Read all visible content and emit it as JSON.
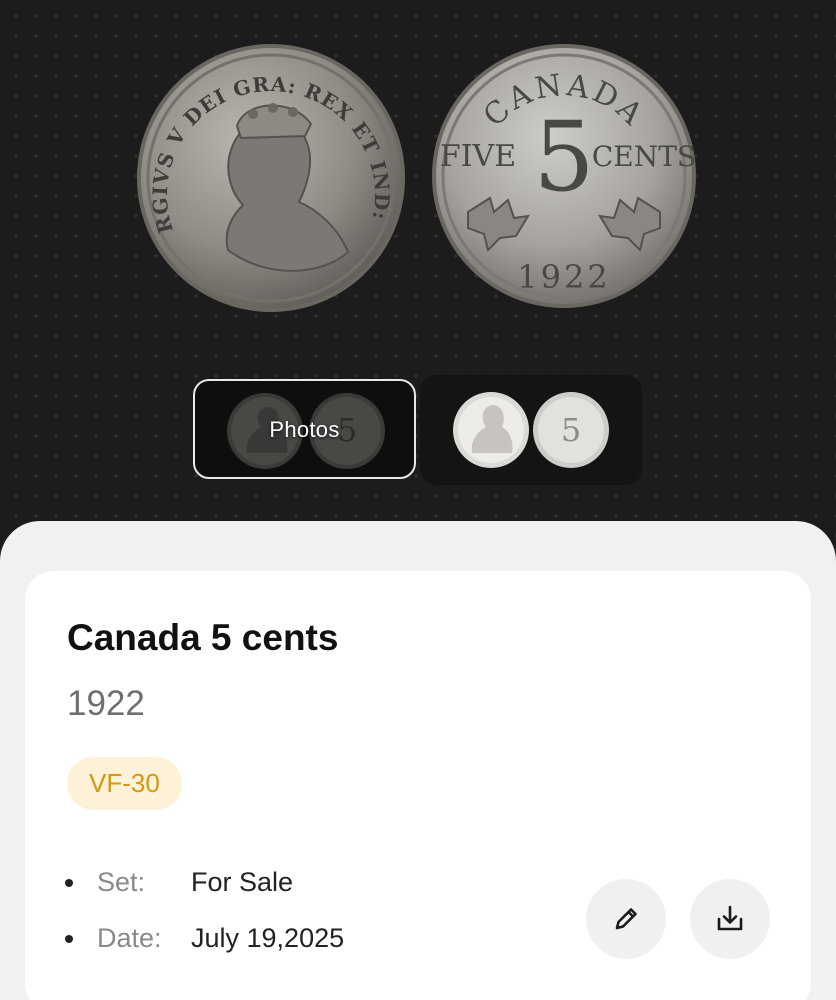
{
  "coin": {
    "obverse_legend": "GEORGIVS V DEI GRA: REX ET IND: IMP:",
    "reverse_country": "CANADA",
    "reverse_left": "FIVE",
    "reverse_center": "5",
    "reverse_right": "CENTS",
    "reverse_year": "1922"
  },
  "gallery": {
    "photos_label": "Photos"
  },
  "details": {
    "title": "Canada 5 cents",
    "year": "1922",
    "grade": "VF-30",
    "set_label": "Set:",
    "set_value": "For Sale",
    "date_label": "Date:",
    "date_value": "July 19,2025"
  },
  "actions": {
    "edit_icon": "pencil-icon",
    "download_icon": "download-icon"
  },
  "colors": {
    "hero_bg": "#1c1c1c",
    "sheet_bg": "#f1f1f1",
    "grade_bg": "#fdf1d8",
    "grade_text": "#d59812"
  }
}
